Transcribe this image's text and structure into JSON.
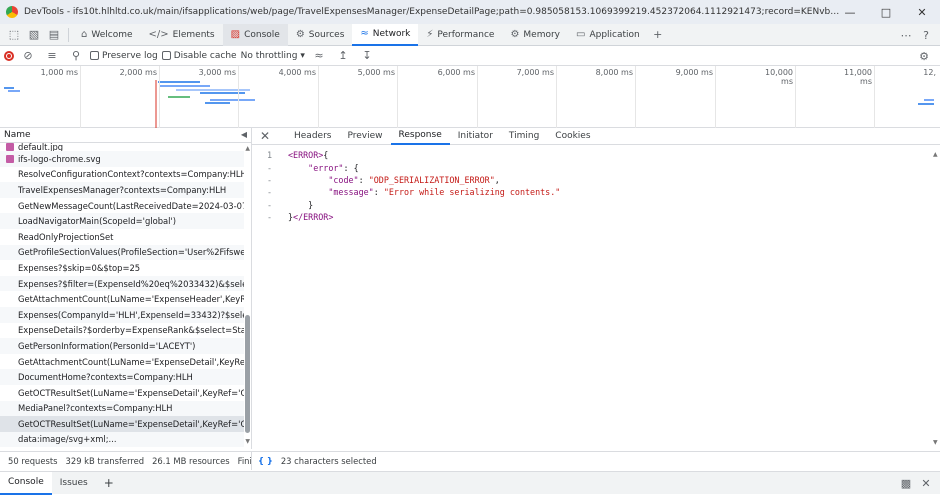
{
  "window": {
    "title": "DevTools - ifs10t.hlhltd.co.uk/main/ifsapplications/web/page/TravelExpensesManager/ExpenseDetailPage;path=0.985058153.1069399219.452372064.1112921473;record=KENvbXBhbnlJZD0nSExIJyxFeHBlbnN..."
  },
  "tabs": [
    {
      "label": "Welcome",
      "icon": "home-icon"
    },
    {
      "label": "Elements",
      "icon": "code-icon"
    },
    {
      "label": "Console",
      "icon": "console-icon"
    },
    {
      "label": "Sources",
      "icon": "sources-icon"
    },
    {
      "label": "Network",
      "icon": "wifi-icon"
    },
    {
      "label": "Performance",
      "icon": "performance-icon"
    },
    {
      "label": "Memory",
      "icon": "memory-icon"
    },
    {
      "label": "Application",
      "icon": "application-icon"
    }
  ],
  "network_toolbar": {
    "preserve_log": "Preserve log",
    "disable_cache": "Disable cache",
    "throttling": "No throttling"
  },
  "timeline": {
    "ticks": [
      "1,000 ms",
      "2,000 ms",
      "3,000 ms",
      "4,000 ms",
      "5,000 ms",
      "6,000 ms",
      "7,000 ms",
      "8,000 ms",
      "9,000 ms",
      "10,000 ms",
      "11,000 ms",
      "12,"
    ]
  },
  "requests": {
    "header": "Name",
    "items": [
      "default.jpg",
      "ifs-logo-chrome.svg",
      "ResolveConfigurationContext?contexts=Company:HLH",
      "TravelExpensesManager?contexts=Company:HLH",
      "GetNewMessageCount(LastReceivedDate=2024-03-07...",
      "LoadNavigatorMain(ScopeId='global')",
      "ReadOnlyProjectionSet",
      "GetProfileSectionValues(ProfileSection='User%2Fifswe...",
      "Expenses?$skip=0&$top=25",
      "Expenses?$filter=(ExpenseId%20eq%2033432)&$selec...",
      "GetAttachmentCount(LuName='ExpenseHeader',KeyR...",
      "Expenses(CompanyId='HLH',ExpenseId=33432)?$selec...",
      "ExpenseDetails?$orderby=ExpenseRank&$select=Stat...",
      "GetPersonInformation(PersonId='LACEYT')",
      "GetAttachmentCount(LuName='ExpenseDetail',KeyRef...",
      "DocumentHome?contexts=Company:HLH",
      "GetOCTResultSet(LuName='ExpenseDetail',KeyRef='C...",
      "MediaPanel?contexts=Company:HLH",
      "GetOCTResultSet(LuName='ExpenseDetail',KeyRef='C...",
      "data:image/svg+xml;..."
    ]
  },
  "detail_tabs": [
    "Headers",
    "Preview",
    "Response",
    "Initiator",
    "Timing",
    "Cookies"
  ],
  "response": {
    "line_numbers": [
      "1",
      "-",
      "-",
      "-",
      "-",
      "-",
      "-"
    ],
    "open_tag": "<ERROR>",
    "close_tag": "</ERROR>",
    "open_brace": "{",
    "error_key": "\"error\"",
    "code_key": "\"code\"",
    "code_value": "\"ODP_SERIALIZATION_ERROR\"",
    "message_key": "\"message\"",
    "message_value": "\"Error while serializing contents.\"",
    "close_brace": "}",
    "close_brace_outer": "}"
  },
  "status": {
    "requests": "50 requests",
    "transferred": "329 kB transferred",
    "resources": "26.1 MB resources",
    "finish": "Finish: 1",
    "braces": "{ }",
    "selection": "23 characters selected"
  },
  "drawer": {
    "console": "Console",
    "issues": "Issues",
    "add": "+"
  },
  "colors": {
    "accent": "#1a73e8",
    "record": "#d93025",
    "xml_tag": "#881280",
    "string": "#c41a16"
  }
}
